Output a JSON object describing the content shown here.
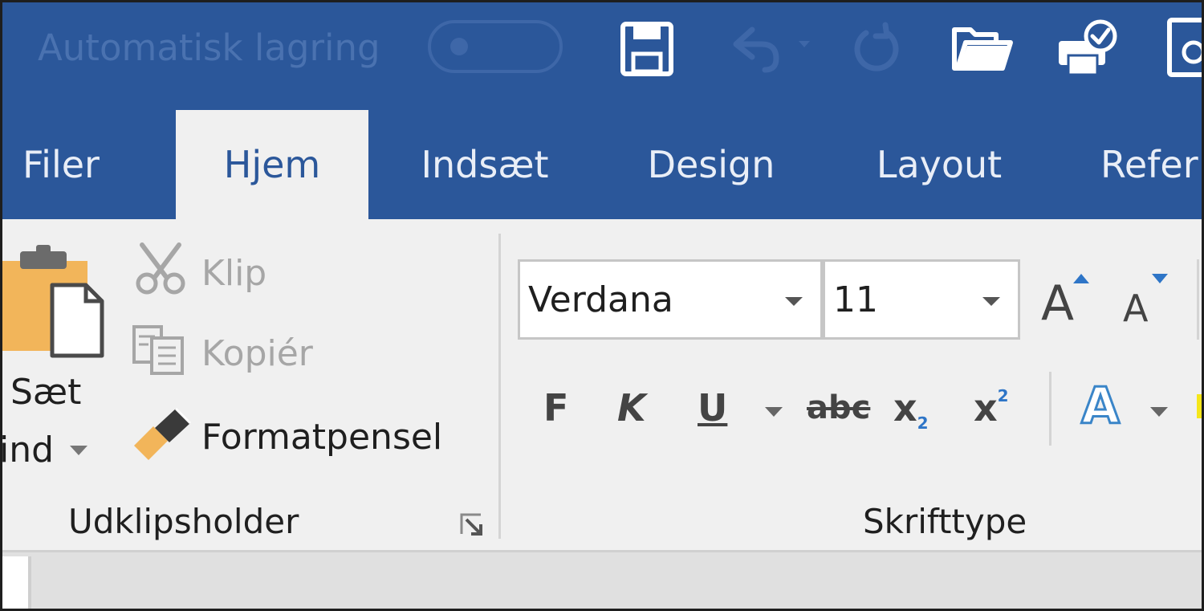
{
  "titlebar": {
    "autosave_label": "Automatisk lagring",
    "qat_icons": [
      "save-icon",
      "undo-icon",
      "redo-icon",
      "open-folder-icon",
      "print-preview-icon",
      "page-icon"
    ]
  },
  "tabs": [
    {
      "label": "Filer"
    },
    {
      "label": "Hjem"
    },
    {
      "label": "Indsæt"
    },
    {
      "label": "Design"
    },
    {
      "label": "Layout"
    },
    {
      "label": "Refer"
    }
  ],
  "clipboard": {
    "paste_label_line1": "Sæt",
    "paste_label_line2": "ind",
    "cut_label": "Klip",
    "copy_label": "Kopiér",
    "format_painter_label": "Formatpensel",
    "group_label": "Udklipsholder"
  },
  "font": {
    "font_name": "Verdana",
    "font_size": "11",
    "bold": "F",
    "italic": "K",
    "underline": "U",
    "strikethrough": "abc",
    "subscript_base": "x",
    "subscript_mark": "2",
    "superscript_base": "x",
    "superscript_mark": "2",
    "grow": "A",
    "shrink": "A",
    "effects": "A",
    "group_label": "Skrifttype"
  },
  "colors": {
    "title_blue": "#2b579a",
    "ribbon_bg": "#f0f0f0",
    "accent_blue": "#3a85c8"
  }
}
